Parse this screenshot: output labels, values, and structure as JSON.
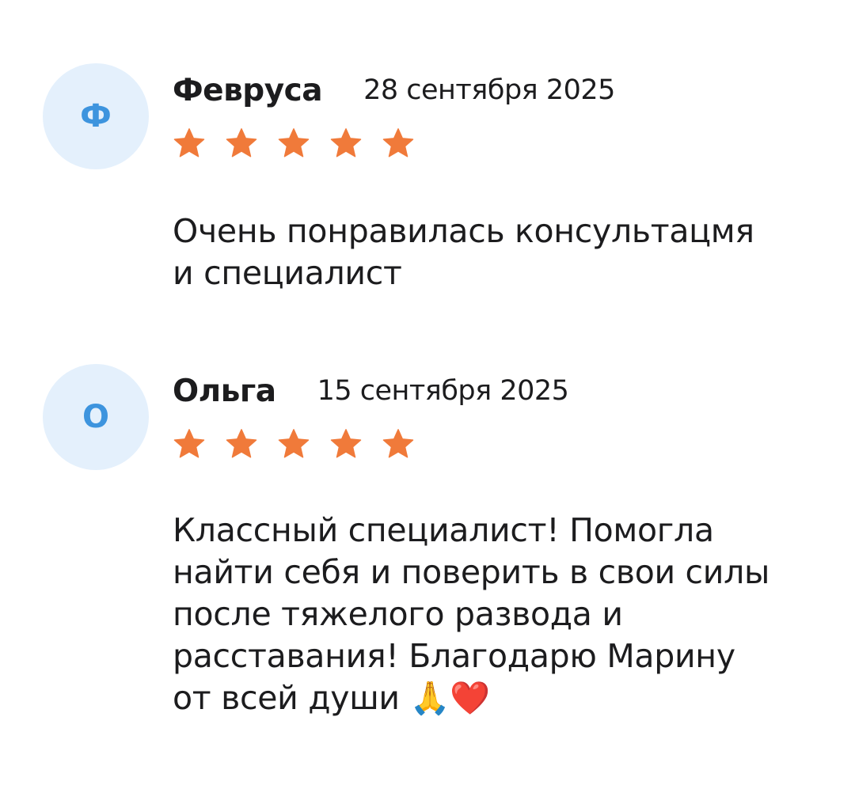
{
  "reviews": [
    {
      "avatar_letter": "Ф",
      "author": "Февруса",
      "date": "28 сентября 2025",
      "rating": 5,
      "text": "Очень понравилась консультацмя\nи специалист"
    },
    {
      "avatar_letter": "О",
      "author": "Ольга",
      "date": "15 сентября 2025",
      "rating": 5,
      "text": "Классный специалист! Помогла\nнайти себя и поверить в свои силы\nпосле тяжелого развода и\nрасставания! Благодарю Марину\nот всей души 🙏❤️"
    }
  ],
  "colors": {
    "star": "#f07a3a",
    "avatar_bg": "#e4f0fc",
    "avatar_letter": "#3d94de",
    "text": "#1c1c1e"
  },
  "icons": {
    "star": "star-icon"
  }
}
